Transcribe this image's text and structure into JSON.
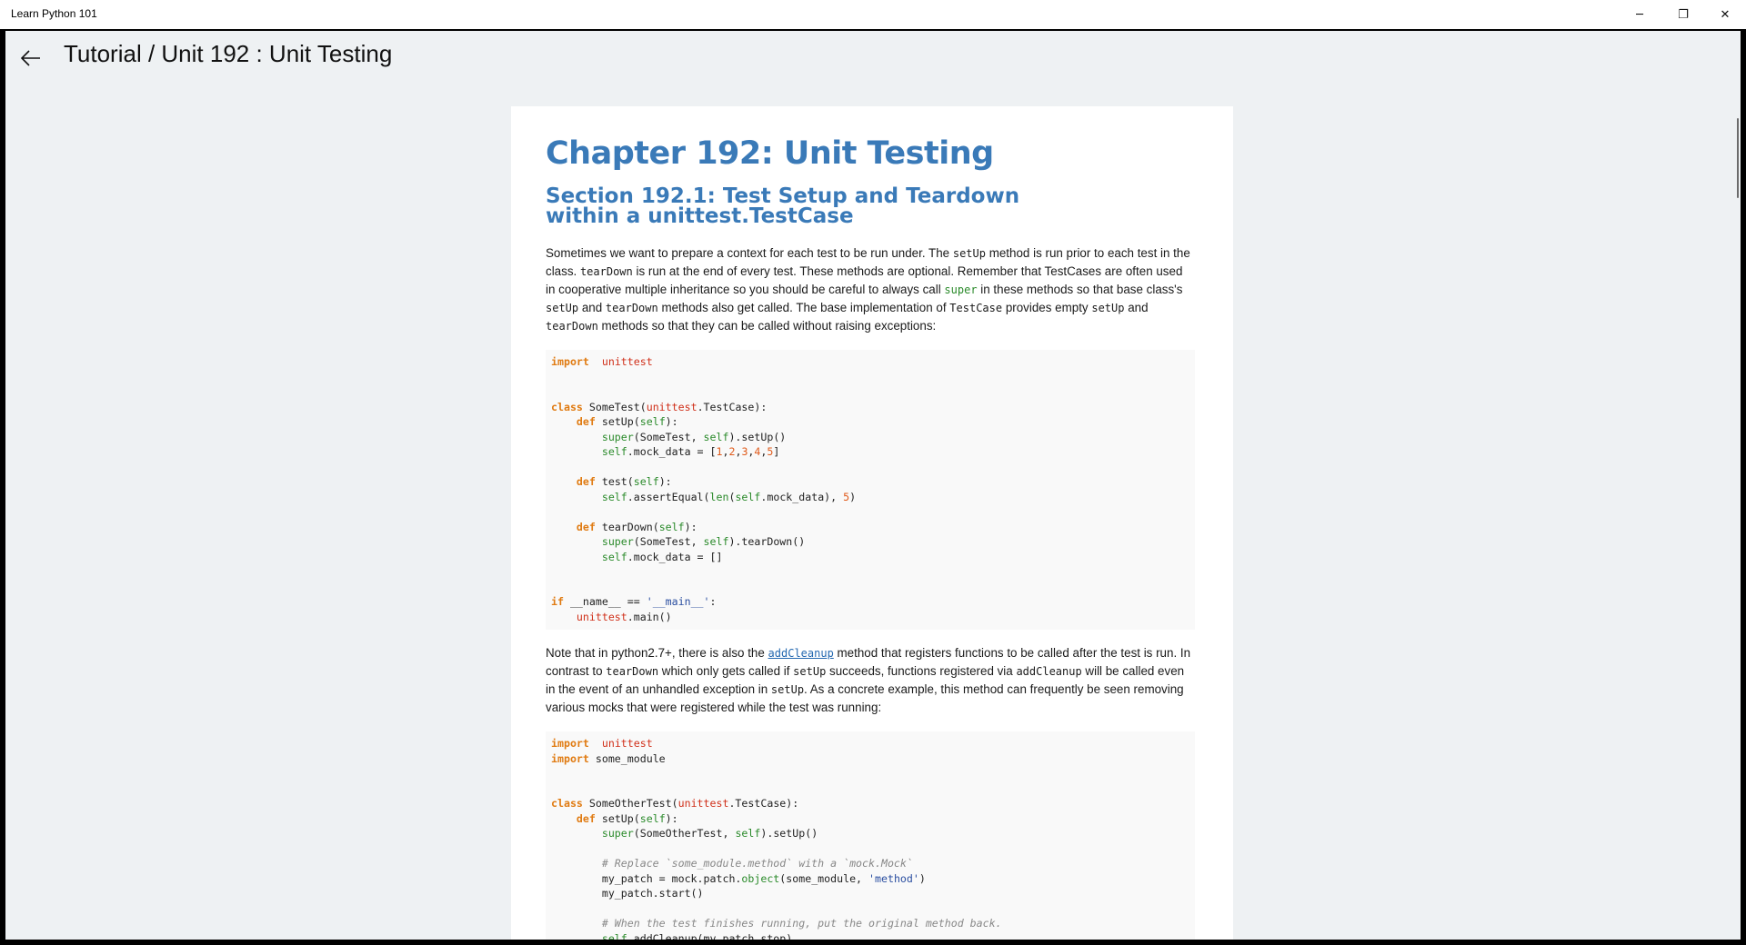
{
  "window": {
    "title": "Learn Python 101",
    "minimize_glyph": "─",
    "maximize_glyph": "❐",
    "close_glyph": "✕"
  },
  "header": {
    "back_icon": "arrow-left-icon",
    "title": "Tutorial / Unit 192 :  Unit Testing"
  },
  "content": {
    "chapter_title": "Chapter 192: Unit Testing",
    "section_title": "Section 192.1: Test Setup and Teardown within a unittest.TestCase",
    "para1": {
      "t1": "Sometimes we want to prepare a context for each test to be run under. The ",
      "c1": "setUp",
      "t2": " method is run prior to each test in the class. ",
      "c2": "tearDown",
      "t3": " is run at the end of every test. These methods are optional. Remember that TestCases are often used in cooperative multiple inheritance so you should be careful to always call ",
      "c3": "super",
      "t4": " in these methods so that base class's ",
      "c4": "setUp",
      "t5": " and ",
      "c5": "tearDown",
      "t6": " methods also get called. The base implementation of ",
      "c6": "TestCase",
      "t7": " provides empty ",
      "c7": "setUp",
      "t8": " and ",
      "c8": "tearDown",
      "t9": " methods so that they can be called without raising exceptions:"
    },
    "para2": {
      "t1": "Note that in python2.7+, there is also the ",
      "link": "addCleanup",
      "t2": " method that registers functions to be called after the test is run. In contrast to ",
      "c1": "tearDown",
      "t3": " which only gets called if ",
      "c2": "setUp",
      "t4": " succeeds, functions registered via ",
      "c3": "addCleanup",
      "t5": " will be called even in the event of an unhandled exception in ",
      "c4": "setUp",
      "t6": ". As a concrete example, this method can frequently be seen removing various mocks that were registered while the test was running:"
    },
    "code1": [
      [
        [
          "kw",
          "import"
        ],
        [
          "",
          "  "
        ],
        [
          "md",
          "unittest"
        ]
      ],
      [],
      [],
      [
        [
          "kw",
          "class"
        ],
        [
          "",
          " SomeTest("
        ],
        [
          "md",
          "unittest"
        ],
        [
          "",
          ".TestCase):"
        ]
      ],
      [
        [
          "",
          "    "
        ],
        [
          "kw",
          "def"
        ],
        [
          "",
          " setUp("
        ],
        [
          "sf",
          "self"
        ],
        [
          "",
          "):"
        ]
      ],
      [
        [
          "",
          "        "
        ],
        [
          "bi",
          "super"
        ],
        [
          "",
          "(SomeTest, "
        ],
        [
          "sf",
          "self"
        ],
        [
          "",
          ").setUp()"
        ]
      ],
      [
        [
          "",
          "        "
        ],
        [
          "sf",
          "self"
        ],
        [
          "",
          ".mock_data = ["
        ],
        [
          "nm",
          "1"
        ],
        [
          "",
          ","
        ],
        [
          "nm",
          "2"
        ],
        [
          "",
          ","
        ],
        [
          "nm",
          "3"
        ],
        [
          "",
          ","
        ],
        [
          "nm",
          "4"
        ],
        [
          "",
          ","
        ],
        [
          "nm",
          "5"
        ],
        [
          "",
          "]"
        ]
      ],
      [],
      [
        [
          "",
          "    "
        ],
        [
          "kw",
          "def"
        ],
        [
          "",
          " test("
        ],
        [
          "sf",
          "self"
        ],
        [
          "",
          "):"
        ]
      ],
      [
        [
          "",
          "        "
        ],
        [
          "sf",
          "self"
        ],
        [
          "",
          ".assertEqual("
        ],
        [
          "bi",
          "len"
        ],
        [
          "",
          "("
        ],
        [
          "sf",
          "self"
        ],
        [
          "",
          ".mock_data), "
        ],
        [
          "nm",
          "5"
        ],
        [
          "",
          ")"
        ]
      ],
      [],
      [
        [
          "",
          "    "
        ],
        [
          "kw",
          "def"
        ],
        [
          "",
          " tearDown("
        ],
        [
          "sf",
          "self"
        ],
        [
          "",
          "):"
        ]
      ],
      [
        [
          "",
          "        "
        ],
        [
          "bi",
          "super"
        ],
        [
          "",
          "(SomeTest, "
        ],
        [
          "sf",
          "self"
        ],
        [
          "",
          ").tearDown()"
        ]
      ],
      [
        [
          "",
          "        "
        ],
        [
          "sf",
          "self"
        ],
        [
          "",
          ".mock_data = []"
        ]
      ],
      [],
      [],
      [
        [
          "kw",
          "if"
        ],
        [
          "",
          " __name__ == "
        ],
        [
          "st",
          "'__main__'"
        ],
        [
          "",
          ":"
        ]
      ],
      [
        [
          "",
          "    "
        ],
        [
          "md",
          "unittest"
        ],
        [
          "",
          ".main()"
        ]
      ]
    ],
    "code2": [
      [
        [
          "kw",
          "import"
        ],
        [
          "",
          "  "
        ],
        [
          "md",
          "unittest"
        ]
      ],
      [
        [
          "kw",
          "import"
        ],
        [
          "",
          " some_module"
        ]
      ],
      [],
      [],
      [
        [
          "kw",
          "class"
        ],
        [
          "",
          " SomeOtherTest("
        ],
        [
          "md",
          "unittest"
        ],
        [
          "",
          ".TestCase):"
        ]
      ],
      [
        [
          "",
          "    "
        ],
        [
          "kw",
          "def"
        ],
        [
          "",
          " setUp("
        ],
        [
          "sf",
          "self"
        ],
        [
          "",
          "):"
        ]
      ],
      [
        [
          "",
          "        "
        ],
        [
          "bi",
          "super"
        ],
        [
          "",
          "(SomeOtherTest, "
        ],
        [
          "sf",
          "self"
        ],
        [
          "",
          ").setUp()"
        ]
      ],
      [],
      [
        [
          "",
          "        "
        ],
        [
          "cm",
          "# Replace `some_module.method` with a `mock.Mock`"
        ]
      ],
      [
        [
          "",
          "        my_patch = mock.patch."
        ],
        [
          "bi",
          "object"
        ],
        [
          "",
          "(some_module, "
        ],
        [
          "st",
          "'method'"
        ],
        [
          "",
          ")"
        ]
      ],
      [
        [
          "",
          "        my_patch.start()"
        ]
      ],
      [],
      [
        [
          "",
          "        "
        ],
        [
          "cm",
          "# When the test finishes running, put the original method back."
        ]
      ],
      [
        [
          "",
          "        "
        ],
        [
          "sf",
          "self"
        ],
        [
          "",
          ".addCleanup(my_patch.stop)"
        ]
      ]
    ]
  }
}
